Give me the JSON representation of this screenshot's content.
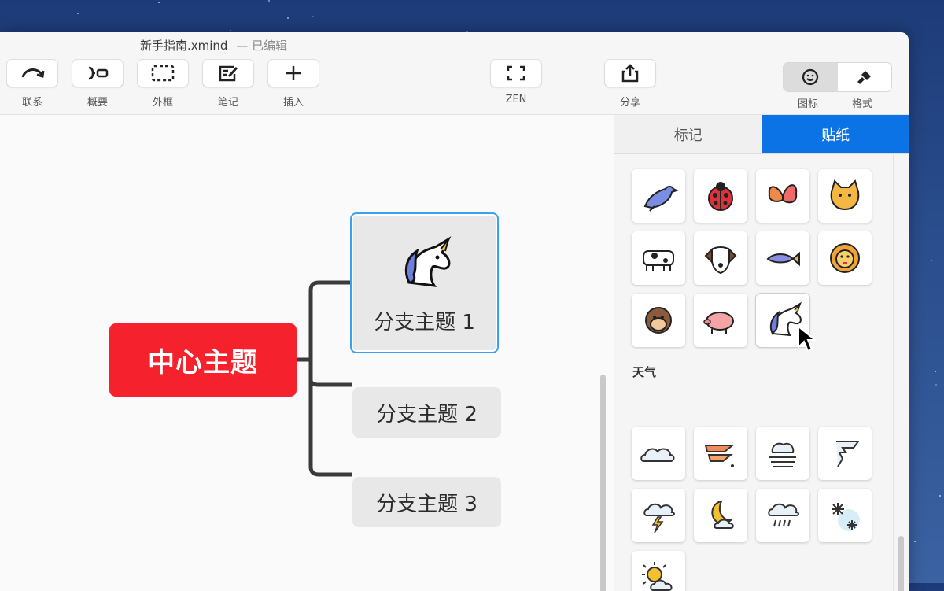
{
  "window": {
    "filename": "新手指南.xmind",
    "status": "— 已编辑"
  },
  "toolbar": {
    "relation": "联系",
    "summary": "概要",
    "boundary": "外框",
    "note": "笔记",
    "insert": "插入",
    "zen": "ZEN",
    "share": "分享",
    "icon": "图标",
    "format": "格式"
  },
  "mindmap": {
    "central": "中心主题",
    "branches": [
      "分支主题 1",
      "分支主题 2",
      "分支主题 3"
    ],
    "central_color": "#f5222d",
    "line_color": "#3a3a3a"
  },
  "panel": {
    "tabs": [
      "标记",
      "贴纸"
    ],
    "active_tab": "贴纸",
    "animals": [
      "bird-icon",
      "ladybug-icon",
      "butterfly-icon",
      "cat-icon",
      "cow-icon",
      "dog-icon",
      "fish-icon",
      "lion-icon",
      "monkey-icon",
      "pig-icon",
      "unicorn-icon"
    ],
    "weather_title": "天气",
    "weather": [
      "cloud-icon",
      "wind-icon",
      "fog-icon",
      "tornado-icon",
      "thunderstorm-icon",
      "moon-cloud-icon",
      "rain-icon",
      "snow-icon",
      "sun-cloud-icon"
    ],
    "accent": "#0b73e6"
  }
}
